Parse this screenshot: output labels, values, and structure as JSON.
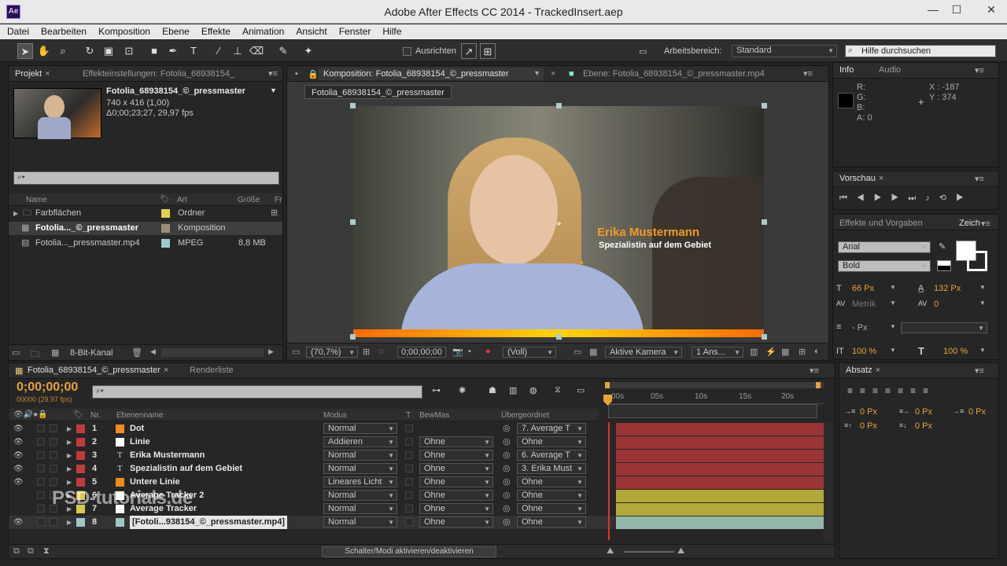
{
  "window": {
    "title": "Adobe After Effects CC 2014 - TrackedInsert.aep",
    "app_icon": "Ae"
  },
  "menu": [
    "Datei",
    "Bearbeiten",
    "Komposition",
    "Ebene",
    "Effekte",
    "Animation",
    "Ansicht",
    "Fenster",
    "Hilfe"
  ],
  "toolbar": {
    "align_label": "Ausrichten",
    "workspace_label": "Arbeitsbereich:",
    "workspace_value": "Standard",
    "help_placeholder": "Hilfe durchsuchen"
  },
  "project": {
    "tab": "Projekt",
    "tab2": "Effekteinstellungen: Fotolia_68938154_",
    "item_name": "Fotolia_68938154_©_pressmaster",
    "item_info1": "740 x 416 (1,00)",
    "item_info2": "Δ0;00;23;27, 29,97 fps",
    "search_placeholder": "⌕▾",
    "columns": [
      "Name",
      "Art",
      "Größe",
      "Fr"
    ],
    "rows": [
      {
        "name": "Farbflächen",
        "type": "Ordner",
        "size": "",
        "color": "#e2d14a"
      },
      {
        "name": "Fotolia..._©_pressmaster",
        "type": "Komposition",
        "size": "",
        "color": "#9a8f7a"
      },
      {
        "name": "Fotolia..._pressmaster.mp4",
        "type": "MPEG",
        "size": "8,8 MB",
        "color": "#9fc9c9"
      }
    ],
    "bitdepth": "8-Bit-Kanal"
  },
  "comp": {
    "tab": "Komposition: Fotolia_68938154_©_pressmaster",
    "tab2": "Ebene: Fotolia_68938154_©_pressmaster.mp4",
    "sub_tab": "Fotolia_68938154_©_pressmaster",
    "lower_third_name": "Erika Mustermann",
    "lower_third_title": "Spezialistin auf dem Gebiet",
    "zoom": "(70,7%)",
    "timecode": "0;00;00;00",
    "resolution": "(Voll)",
    "camera": "Aktive Kamera",
    "view": "1 Ans..."
  },
  "info": {
    "tab": "Info",
    "tab2": "Audio",
    "r": "R:",
    "g": "G:",
    "b": "B:",
    "a": "A:  0",
    "x": "X : -187",
    "y": "Y : 374"
  },
  "preview": {
    "tab": "Vorschau"
  },
  "effects": {
    "tab": "Effekte und Vorgaben",
    "tab2": "Zeich",
    "font": "Arial",
    "style": "Bold",
    "size": "66 Px",
    "leading": "132 Px",
    "kerning": "Metrik",
    "tracking": "0",
    "stroke": "- Px",
    "vscale": "100 %",
    "hscale": "100 %"
  },
  "paragraph": {
    "tab": "Absatz",
    "indent1": "0 Px",
    "indent2": "0 Px",
    "indent3": "0 Px",
    "space1": "0 Px",
    "space2": "0 Px"
  },
  "timeline": {
    "tab": "Fotolia_68938154_©_pressmaster",
    "tab2": "Renderliste",
    "timecode": "0;00;00;00",
    "frames": "00000 (29.97 fps)",
    "columns": [
      "Nr.",
      "Ebenenname",
      "Modus",
      "T",
      "BewMas",
      "Übergeordnet"
    ],
    "ruler": [
      "00s",
      "05s",
      "10s",
      "15s",
      "20s"
    ],
    "toggle_label": "Schalter/Modi aktivieren/deaktivieren",
    "layers": [
      {
        "nr": "1",
        "name": "Dot",
        "mode": "Normal",
        "trkmat": "",
        "parent": "7. Average T",
        "label": "#c23b3b",
        "swatch": "#f08c1e",
        "bar": "#9b3535",
        "eye": true
      },
      {
        "nr": "2",
        "name": "Linie",
        "mode": "Addieren",
        "trkmat": "Ohne",
        "parent": "Ohne",
        "label": "#c23b3b",
        "swatch": "#ffffff",
        "bar": "#9b3535",
        "eye": true
      },
      {
        "nr": "3",
        "name": "Erika Mustermann",
        "mode": "Normal",
        "trkmat": "Ohne",
        "parent": "6. Average T",
        "label": "#c23b3b",
        "swatch": "T",
        "bar": "#9b3535",
        "eye": true
      },
      {
        "nr": "4",
        "name": "Spezialistin auf dem Gebiet",
        "mode": "Normal",
        "trkmat": "Ohne",
        "parent": "3. Erika Must",
        "label": "#c23b3b",
        "swatch": "T",
        "bar": "#9b3535",
        "eye": true
      },
      {
        "nr": "5",
        "name": "Untere Linie",
        "mode": "Lineares Licht",
        "trkmat": "Ohne",
        "parent": "Ohne",
        "label": "#c23b3b",
        "swatch": "#f08c1e",
        "bar": "#9b3535",
        "eye": true
      },
      {
        "nr": "6",
        "name": "Average Tracker 2",
        "mode": "Normal",
        "trkmat": "Ohne",
        "parent": "Ohne",
        "label": "#d9c84a",
        "swatch": "#ffffff",
        "bar": "#b3a93a",
        "eye": false
      },
      {
        "nr": "7",
        "name": "Average Tracker",
        "mode": "Normal",
        "trkmat": "Ohne",
        "parent": "Ohne",
        "label": "#d9c84a",
        "swatch": "#ffffff",
        "bar": "#b3a93a",
        "eye": false
      },
      {
        "nr": "8",
        "name": "[Fotoli...938154_©_pressmaster.mp4]",
        "mode": "Normal",
        "trkmat": "Ohne",
        "parent": "Ohne",
        "label": "#9fc9c9",
        "swatch": "#9fc9c9",
        "bar": "#93b6aa",
        "eye": true
      }
    ]
  },
  "watermark": "PSD-tutorials.de"
}
